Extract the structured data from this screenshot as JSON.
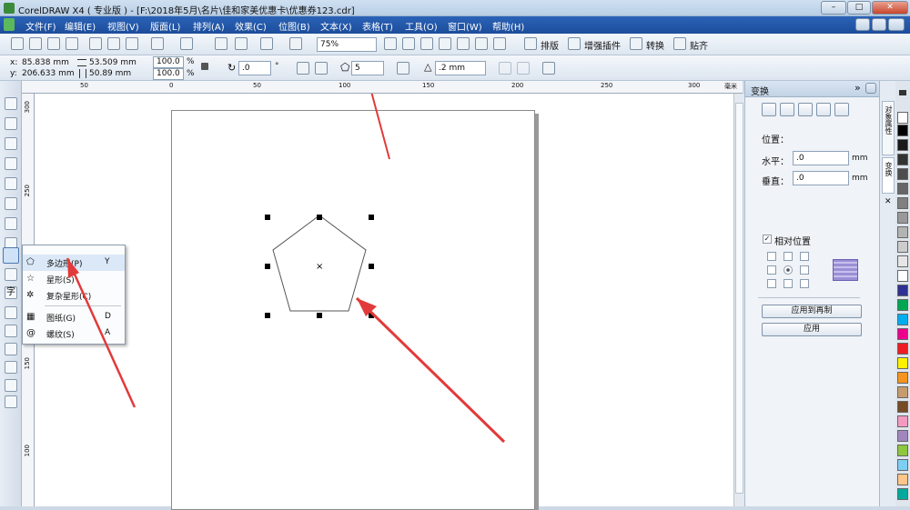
{
  "window": {
    "title": "CorelDRAW X4 ( 专业版 ) - [F:\\2018年5月\\名片\\佳和家美优惠卡\\优惠券123.cdr]",
    "controls": [
      "–",
      "□",
      "✕"
    ]
  },
  "menu": [
    "文件(F)",
    "编辑(E)",
    "视图(V)",
    "版面(L)",
    "排列(A)",
    "效果(C)",
    "位图(B)",
    "文本(X)",
    "表格(T)",
    "工具(O)",
    "窗口(W)",
    "帮助(H)"
  ],
  "toolbar1": {
    "zoom": "75%",
    "buttons": [
      "排版",
      "增强插件",
      "转换",
      "贴齐"
    ]
  },
  "property_bar": {
    "x_label": "x:",
    "x_value": "85.838 mm",
    "y_label": "y:",
    "y_value": "206.633 mm",
    "width_value": "53.509 mm",
    "height_value": "50.89 mm",
    "scale_x": "100.0",
    "scale_y": "100.0",
    "percent": "%",
    "rotation": ".0",
    "degree": "°",
    "sides": "5",
    "outline": ".2 mm"
  },
  "rulers": {
    "top": [
      "50",
      "0",
      "50",
      "100",
      "150",
      "200",
      "250",
      "300",
      "毫米"
    ],
    "left": [
      "300",
      "250",
      "200",
      "150",
      "100"
    ]
  },
  "flyout": [
    {
      "icon": "polygon-icon",
      "label": "多边形(P)",
      "key": "Y"
    },
    {
      "icon": "star-icon",
      "label": "星形(S)",
      "key": ""
    },
    {
      "icon": "complex-star-icon",
      "label": "复杂星形(C)",
      "key": ""
    },
    {
      "icon": "graph-paper-icon",
      "label": "图纸(G)",
      "key": "D"
    },
    {
      "icon": "spiral-icon",
      "label": "螺纹(S)",
      "key": "A"
    }
  ],
  "docker": {
    "title": "变换",
    "position_label": "位置：",
    "h_label": "水平：",
    "h_value": ".0",
    "v_label": "垂直：",
    "v_value": ".0",
    "unit": "mm",
    "relative_label": "相对位置",
    "apply_dup": "应用到再制",
    "apply": "应用"
  },
  "side_tabs": [
    "对象属性",
    "变换"
  ],
  "palette": [
    "#ffffff",
    "#000000",
    "#1a1a1a",
    "#333333",
    "#4d4d4d",
    "#666666",
    "#808080",
    "#999999",
    "#b3b3b3",
    "#cccccc",
    "#e6e6e6",
    "#ffffff",
    "#2e3192",
    "#00a651",
    "#00aeef",
    "#ec008c",
    "#ed1c24",
    "#fff200",
    "#f7941d",
    "#c69c6d",
    "#754c24",
    "#f49ac1",
    "#a186be",
    "#8dc63f",
    "#7ecef4",
    "#fdc68a",
    "#00a99d"
  ]
}
